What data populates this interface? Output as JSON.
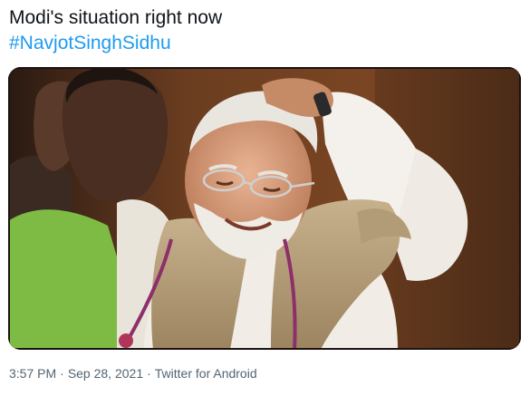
{
  "tweet": {
    "text_line1": "Modi's situation right now",
    "hashtag": "#NavjotSinghSidhu",
    "media": {
      "alt": "Photo"
    },
    "meta": {
      "time": "3:57 PM",
      "separator": "·",
      "date": "Sep 28, 2021",
      "source": "Twitter for Android"
    }
  },
  "colors": {
    "link": "#1d9bf0",
    "text": "#0f1419",
    "secondary": "#536471"
  }
}
